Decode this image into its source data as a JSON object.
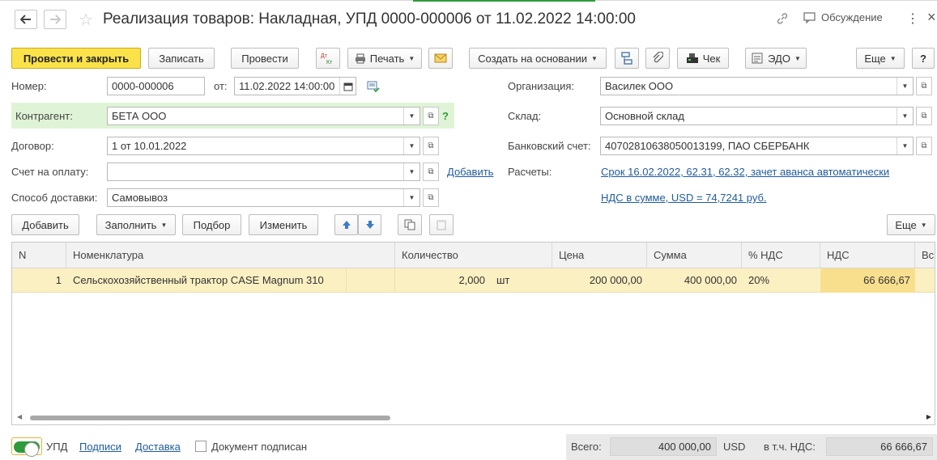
{
  "window": {
    "title": "Реализация товаров: Накладная, УПД 0000-000006 от 11.02.2022 14:00:00",
    "discussion_label": "Обсуждение",
    "more_menu": "⋮",
    "close": "×"
  },
  "toolbar": {
    "post_close": "Провести и закрыть",
    "save": "Записать",
    "post": "Провести",
    "dt_kt": "Дт Кт",
    "print": "Печать",
    "create_based_on": "Создать на основании",
    "check": "Чек",
    "edo": "ЭДО",
    "more": "Еще",
    "help": "?"
  },
  "form": {
    "number_label": "Номер:",
    "number_value": "0000-000006",
    "date_label": "от:",
    "date_value": "11.02.2022 14:00:00",
    "counterparty_label": "Контрагент:",
    "counterparty_value": "БЕТА ООО",
    "counterparty_hint": "?",
    "contract_label": "Договор:",
    "contract_value": "1 от 10.01.2022",
    "invoice_label": "Счет на оплату:",
    "invoice_value": "",
    "add_link": "Добавить",
    "delivery_label": "Способ доставки:",
    "delivery_value": "Самовывоз",
    "org_label": "Организация:",
    "org_value": "Василек ООО",
    "warehouse_label": "Склад:",
    "warehouse_value": "Основной склад",
    "bank_label": "Банковский счет:",
    "bank_value": "40702810638050013199, ПАО СБЕРБАНК",
    "settlements_label": "Расчеты:",
    "settlements_link": "Срок 16.02.2022, 62.31, 62.32, зачет аванса автоматически",
    "vat_link": "НДС в сумме, USD = 74,7241 руб."
  },
  "table_toolbar": {
    "add": "Добавить",
    "fill": "Заполнить",
    "pick": "Подбор",
    "change": "Изменить",
    "more": "Еще"
  },
  "table": {
    "headers": [
      "N",
      "Номенклатура",
      "Количество",
      "Цена",
      "Сумма",
      "% НДС",
      "НДС",
      "Вс"
    ],
    "rows": [
      {
        "n": "1",
        "item": "Сельскохозяйственный трактор CASE Magnum 310",
        "qty": "2,000",
        "unit": "шт",
        "price": "200 000,00",
        "sum": "400 000,00",
        "vat_rate": "20%",
        "vat": "66 666,67"
      }
    ]
  },
  "footer": {
    "upd_label": "УПД",
    "signatures_link": "Подписи",
    "delivery_link": "Доставка",
    "signed_label": "Документ подписан",
    "total_label": "Всего:",
    "total_value": "400 000,00",
    "currency": "USD",
    "vat_incl_label": "в т.ч. НДС:",
    "vat_total_value": "66 666,67"
  },
  "colors": {
    "primary_button": "#fbe24a",
    "link": "#1f5b9c",
    "selected_row": "#fbf0c2",
    "toggle_on": "#2e9a3a",
    "counterparty_highlight": "#dff4d6"
  }
}
